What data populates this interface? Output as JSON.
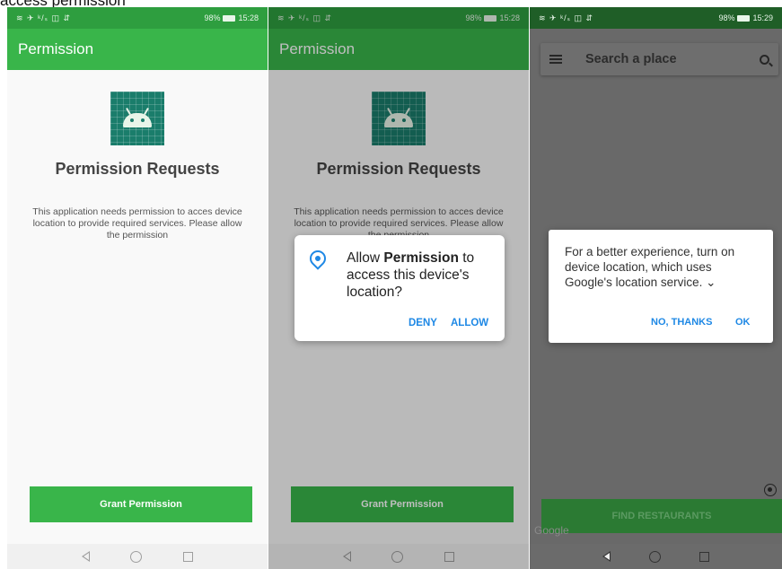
{
  "caption": "access permission",
  "colors": {
    "app_green": "#39b54a",
    "link_blue": "#1e88e5",
    "robot_teal": "#1a7d6b"
  },
  "screen1": {
    "status": {
      "left": "≋ ✈ ᵏ/ₛ ◫ ⇵",
      "battery": "98%",
      "time": "15:28"
    },
    "appbar_title": "Permission",
    "icon": "android-robot-icon",
    "title": "Permission Requests",
    "description": "This application needs permission to acces device location to provide required services. Please allow the permission",
    "grant_button": "Grant Permission"
  },
  "screen2": {
    "status": {
      "left": "≋ ✈ ᵏ/ₛ ◫ ⇵",
      "battery": "98%",
      "time": "15:28"
    },
    "appbar_title": "Permission",
    "title": "Permission Requests",
    "description": "This application needs permission to acces device location to provide required services. Please allow the permission",
    "grant_button": "Grant Permission",
    "dialog": {
      "prefix": "Allow ",
      "bold": "Permission",
      "suffix": " to access this device's location?",
      "deny": "DENY",
      "allow": "ALLOW"
    }
  },
  "screen3": {
    "status": {
      "left": "≋ ✈ ᵏ/ₛ ◫ ⇵",
      "battery": "98%",
      "time": "15:29"
    },
    "search_placeholder": "Search a place",
    "dialog": {
      "text": "For a better experience, turn on device location, which uses Google's location service. ⌄",
      "no_thanks": "NO, THANKS",
      "ok": "OK"
    },
    "find_button": "FIND RESTAURANTS",
    "google_logo": "Google"
  }
}
